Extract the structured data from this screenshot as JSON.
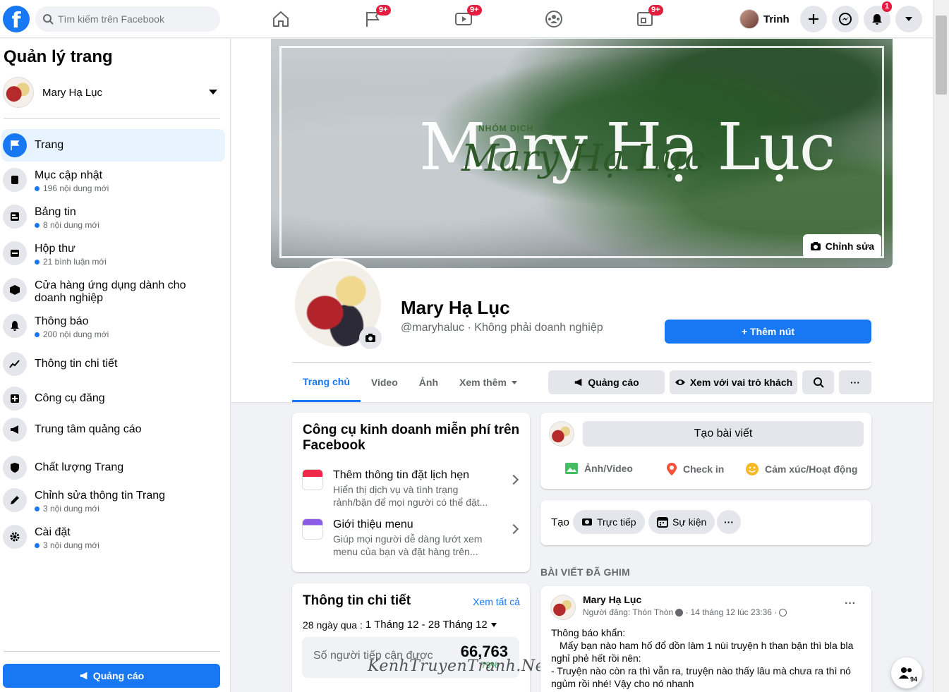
{
  "topbar": {
    "search_placeholder": "Tìm kiếm trên Facebook",
    "badges": {
      "pages": "9+",
      "watch": "9+",
      "gaming": "9+",
      "notifications": "1"
    },
    "user_name": "Trinh"
  },
  "sidebar": {
    "title": "Quản lý trang",
    "selected_page": "Mary Hạ Lục",
    "items": [
      {
        "label": "Trang",
        "sub": ""
      },
      {
        "label": "Mục cập nhật",
        "sub": "196 nội dung mới"
      },
      {
        "label": "Bảng tin",
        "sub": "8 nội dung mới"
      },
      {
        "label": "Hộp thư",
        "sub": "21 bình luận mới"
      },
      {
        "label": "Cửa hàng ứng dụng dành cho doanh nghiệp",
        "sub": ""
      },
      {
        "label": "Thông báo",
        "sub": "200 nội dung mới"
      },
      {
        "label": "Thông tin chi tiết",
        "sub": ""
      },
      {
        "label": "Công cụ đăng",
        "sub": ""
      },
      {
        "label": "Trung tâm quảng cáo",
        "sub": ""
      },
      {
        "label": "Chất lượng Trang",
        "sub": ""
      },
      {
        "label": "Chỉnh sửa thông tin Trang",
        "sub": "3 nội dung mới"
      },
      {
        "label": "Cài đặt",
        "sub": "3 nội dung mới"
      }
    ],
    "ad_button": "Quảng cáo"
  },
  "cover": {
    "small_text": "NHÓM DỊCH",
    "big_text": "Mary Hạ Lục",
    "script_text": "Mary Hạ Lục",
    "edit_label": "Chỉnh sửa"
  },
  "page": {
    "name": "Mary Hạ Lục",
    "handle": "@maryhaluc · Không phải doanh nghiệp",
    "add_button": "+ Thêm nút"
  },
  "tabs": [
    "Trang chủ",
    "Video",
    "Ảnh",
    "Xem thêm"
  ],
  "hero_buttons": {
    "ads": "Quảng cáo",
    "view_as": "Xem với vai trò khách",
    "more": "···"
  },
  "biz_card": {
    "title": "Công cụ kinh doanh miễn phí trên Facebook",
    "items": [
      {
        "title": "Thêm thông tin đặt lịch hẹn",
        "desc": "Hiển thị dịch vụ và tình trạng rảnh/bận để mọi người có thể đặt..."
      },
      {
        "title": "Giới thiệu menu",
        "desc": "Giúp mọi người dễ dàng lướt xem menu của bạn và đặt hàng trên..."
      }
    ]
  },
  "insights_card": {
    "title": "Thông tin chi tiết",
    "see_all": "Xem tất cả",
    "range_label": "28 ngày qua :",
    "range_value": "1 Tháng 12 - 28 Tháng 12",
    "reach_label": "Số người tiếp cận được",
    "reach_value": "66,763",
    "reach_change": "79%"
  },
  "create_card": {
    "input": "Tạo bài viết",
    "photo": "Ảnh/Video",
    "checkin": "Check in",
    "feeling": "Cảm xúc/Hoạt động"
  },
  "tao_card": {
    "label": "Tạo",
    "live": "Trực tiếp",
    "event": "Sự kiện",
    "more": "···"
  },
  "pinned": {
    "section": "BÀI VIẾT ĐÃ GHIM",
    "author": "Mary Hạ Lục",
    "meta": "Người đăng: Thón Thòn",
    "meta_time": "· 14 tháng 12 lúc 23:36 ·",
    "more": "···",
    "line1": "Thông báo khẩn:",
    "line2": "Mấy bạn nào ham hố đổ dồn làm 1 nùi truyện h than bận thì bla bla",
    "line3": "nghỉ phẻ hết rồi nên:",
    "line4": "- Truyện nào còn ra thì vẫn ra, truyện nào thấy lâu mà chưa ra thì nó",
    "line5": "ngủm rồi nhé! Vậy cho nó nhanh"
  },
  "watermark": "KenhTruyenTranh.Net",
  "contacts_count": "94",
  "colors": {
    "accent": "#1877f2",
    "badge": "#e41e3f"
  }
}
